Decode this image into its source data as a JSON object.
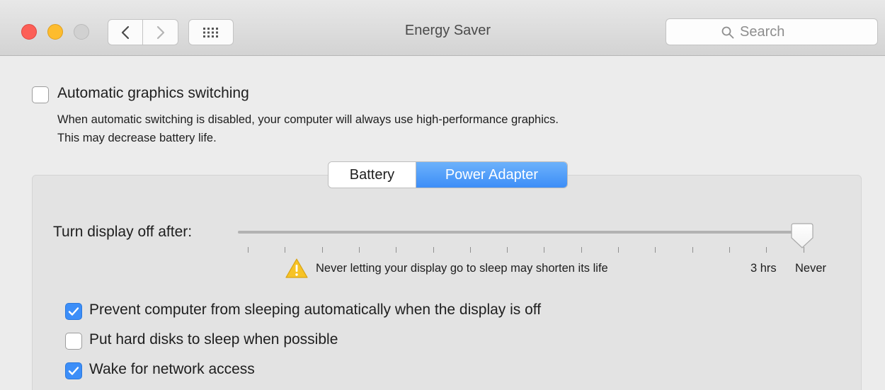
{
  "window": {
    "title": "Energy Saver"
  },
  "search": {
    "placeholder": "Search"
  },
  "graphics": {
    "checkbox_label": "Automatic graphics switching",
    "checked": false,
    "description_line1": "When automatic switching is disabled, your computer will always use high-performance graphics.",
    "description_line2": "This may decrease battery life."
  },
  "tabs": [
    {
      "label": "Battery",
      "selected": false
    },
    {
      "label": "Power Adapter",
      "selected": true
    }
  ],
  "display_sleep": {
    "label": "Turn display off after:",
    "selected_value": "Never",
    "warning": "Never letting your display go to sleep may shorten its life",
    "tick_labels": [
      "3 hrs",
      "Never"
    ]
  },
  "options": [
    {
      "label": "Prevent computer from sleeping automatically when the display is off",
      "checked": true
    },
    {
      "label": "Put hard disks to sleep when possible",
      "checked": false
    },
    {
      "label": "Wake for network access",
      "checked": true
    }
  ],
  "colors": {
    "accent": "#3c8ef8",
    "close": "#fc5f57",
    "minimize": "#fdbc2e",
    "zoom_disabled": "#d1d1d1",
    "warning": "#f7c325"
  },
  "icons": {
    "back": "chevron-left-icon",
    "forward": "chevron-right-icon",
    "show_all": "grid-icon",
    "search": "magnifier-icon",
    "warning": "warning-triangle-icon",
    "checkmark": "checkmark-icon"
  }
}
